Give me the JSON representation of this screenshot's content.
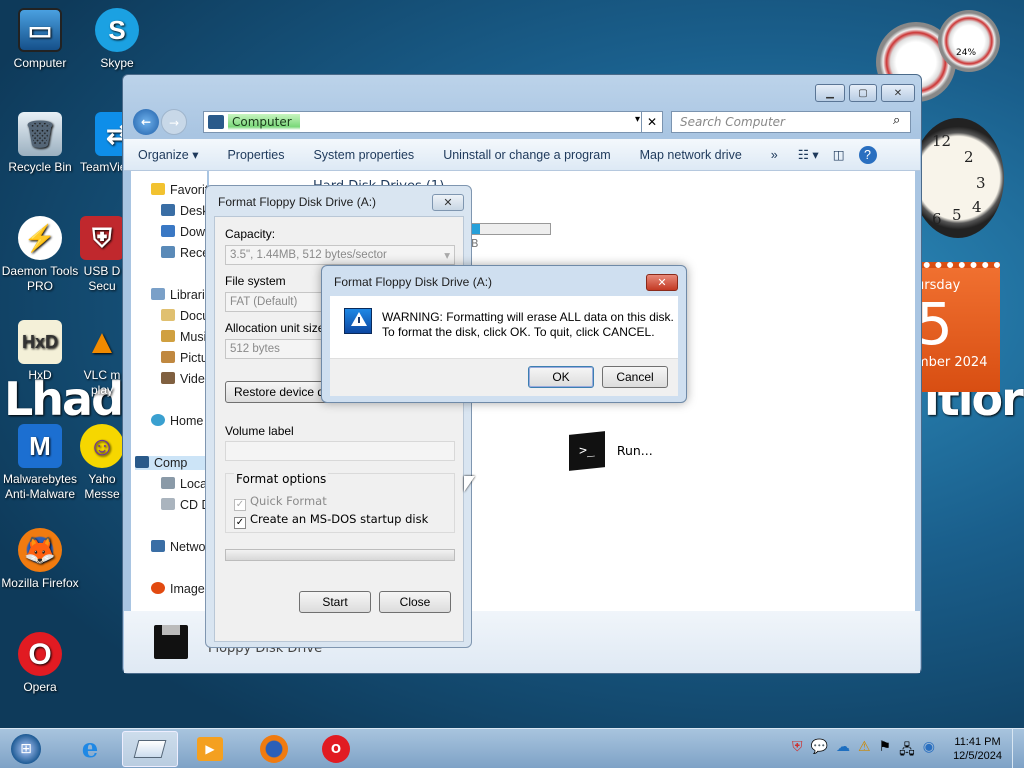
{
  "desktop": {
    "icons": [
      {
        "label": "Computer"
      },
      {
        "label": "Skype"
      },
      {
        "label": "Recycle Bin"
      },
      {
        "label": "TeamVie"
      },
      {
        "label": "Daemon Tools PRO"
      },
      {
        "label": "USB D Secu"
      },
      {
        "label": "HxD"
      },
      {
        "label": "VLC m play"
      },
      {
        "label": "Malwarebytes Anti-Malware"
      },
      {
        "label": "Yaho Messe"
      },
      {
        "label": "Mozilla Firefox"
      },
      {
        "label": "Opera"
      }
    ],
    "wallpaper_text_left": "Lhad",
    "wallpaper_text_right": "itior"
  },
  "gadgets": {
    "clock_numbers": [
      "12",
      "2",
      "3",
      "4",
      "5",
      "6"
    ],
    "calendar": {
      "weekday": "ursday",
      "day": "5",
      "month_year": "mber 2024"
    },
    "meter_label": "24%"
  },
  "explorer": {
    "address": {
      "crumb": "Computer"
    },
    "search_placeholder": "Search Computer",
    "toolbar": {
      "organize": "Organize ▾",
      "properties": "Properties",
      "system_properties": "System properties",
      "uninstall": "Uninstall or change a program",
      "map_drive": "Map network drive",
      "more": "»"
    },
    "nav": {
      "favorites": "Favorit",
      "desktop": "Desk",
      "downloads": "Dow",
      "recent": "Rece",
      "libraries": "Librari",
      "documents": "Docu",
      "music": "Musi",
      "pictures": "Pictu",
      "videos": "Vide",
      "homegroup": "Home",
      "computer": "Comp",
      "local": "Loca",
      "cd": "CD D",
      "network": "Netwo",
      "image": "Image"
    },
    "content": {
      "section_header": "Hard Disk Drives (1)",
      "drive_size_suffix": "B",
      "run_label": "Run..."
    },
    "details": {
      "drive_name": "Floppy Disk Drive"
    }
  },
  "format_dialog": {
    "title": "Format Floppy Disk Drive (A:)",
    "capacity_label": "Capacity:",
    "capacity_value": "3.5\",  1.44MB, 512 bytes/sector",
    "fs_label": "File system",
    "fs_value": "FAT (Default)",
    "alloc_label": "Allocation unit size",
    "alloc_value": "512 bytes",
    "restore_button": "Restore device de",
    "volume_label": "Volume label",
    "format_options": "Format options",
    "quick_format": "Quick Format",
    "msdos_disk": "Create an MS-DOS startup disk",
    "start_button": "Start",
    "close_button": "Close"
  },
  "warning_dialog": {
    "title": "Format Floppy Disk Drive (A:)",
    "line1": "WARNING: Formatting will erase ALL data on this disk.",
    "line2": "To format the disk, click OK. To quit, click CANCEL.",
    "ok": "OK",
    "cancel": "Cancel"
  },
  "taskbar": {
    "time": "11:41 PM",
    "date": "12/5/2024"
  }
}
